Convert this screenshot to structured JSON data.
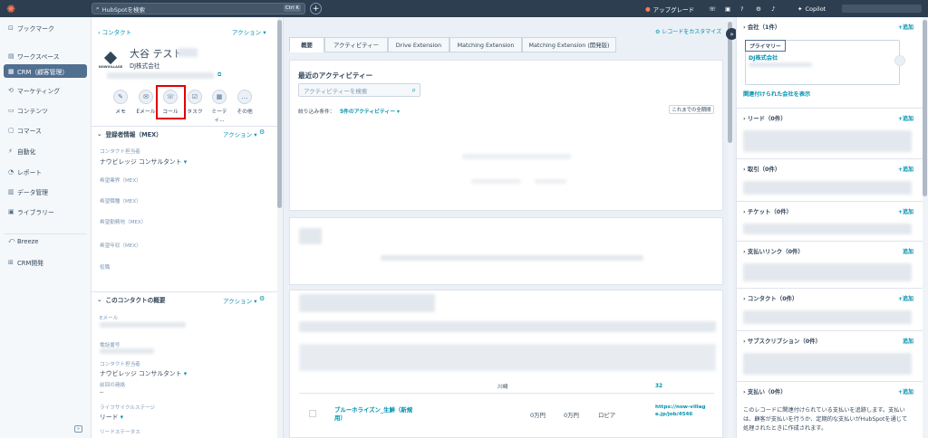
{
  "topbar": {
    "search_placeholder": "HubSpotを検索",
    "shortcut": "Ctrl K",
    "upgrade": "アップグレード",
    "copilot": "Copilot"
  },
  "sidebar": {
    "items": [
      "ブックマーク",
      "ワークスペース",
      "CRM（顧客管理）",
      "マーケティング",
      "コンテンツ",
      "コマース",
      "自動化",
      "レポート",
      "データ管理",
      "ライブラリー",
      "Breeze",
      "CRM開発"
    ],
    "icons": [
      "bookmark-icon",
      "workspace-icon",
      "crm-icon",
      "marketing-icon",
      "content-icon",
      "commerce-icon",
      "automation-icon",
      "report-icon",
      "data-icon",
      "library-icon",
      "breeze-icon",
      "dev-icon"
    ]
  },
  "contact": {
    "back": "‹ コンタクト",
    "actions": "アクション",
    "name": "大谷 テスト",
    "company": "DJ株式会社",
    "logo_text": "NOWVILLAGE",
    "buttons": [
      "メモ",
      "Eメール",
      "コール",
      "タスク",
      "ミーティ...",
      "その他"
    ]
  },
  "registration": {
    "title": "登録者情報（MEX）",
    "actions": "アクション",
    "owner_label": "コンタクト担当者",
    "owner_value": "ナウビレッジ コンサルタント",
    "fields": [
      "希望業界（MEX）",
      "希望職種（MEX）",
      "希望勤務地（MEX）",
      "希望年収（MEX）",
      "役職"
    ]
  },
  "overview": {
    "title": "このコンタクトの概要",
    "actions": "アクション",
    "email_label": "Eメール",
    "phone_label": "電話番号",
    "owner_label": "コンタクト担当者",
    "owner_value": "ナウビレッジ コンサルタント",
    "last_contact_label": "前回の連絡",
    "last_contact_value": "--",
    "lifecycle_label": "ライフサイクルステージ",
    "lifecycle_value": "リード",
    "lead_status_label": "リードステータス"
  },
  "middle": {
    "customize": "レコードをカスタマイズ",
    "tabs": [
      "概要",
      "アクティビティー",
      "Drive Extension",
      "Matching Extension",
      "Matching Extension (開発版)"
    ],
    "recent_title": "最近のアクティビティー",
    "activity_search": "アクティビティーを検索",
    "filter_label": "絞り込み条件：",
    "filter_value": "5件のアクティビティー",
    "all_activity": "これまでの全期間",
    "row": {
      "title": "ブルーホライズン_生鮮（新規用）",
      "col1": "0万円",
      "col2": "0万円",
      "col3": "ロピア",
      "url": "https://now-village.jp/job/4546",
      "url_prev": "32",
      "partial": "川崎"
    }
  },
  "right": {
    "sections": [
      {
        "title": "会社（1件）",
        "add": "+追加"
      },
      {
        "title": "リード（0件）",
        "add": "+追加"
      },
      {
        "title": "取引（0件）",
        "add": "+追加"
      },
      {
        "title": "チケット（0件）",
        "add": "+追加"
      },
      {
        "title": "支払いリンク（0件）",
        "add": "追加"
      },
      {
        "title": "コンタクト（0件）",
        "add": "+追加"
      },
      {
        "title": "サブスクリプション（0件）",
        "add": "追加"
      },
      {
        "title": "支払い（0件）",
        "add": "+追加"
      }
    ],
    "primary_badge": "プライマリー",
    "company_name": "DJ株式会社",
    "show_companies": "関連付けられた会社を表示",
    "payments_text": "このレコードに関連付けられている支払いを追跡します。支払いは、顧客が支払いを行うか、定期的な支払いがHubSpotを通じて処理されたときに作成されます。"
  }
}
